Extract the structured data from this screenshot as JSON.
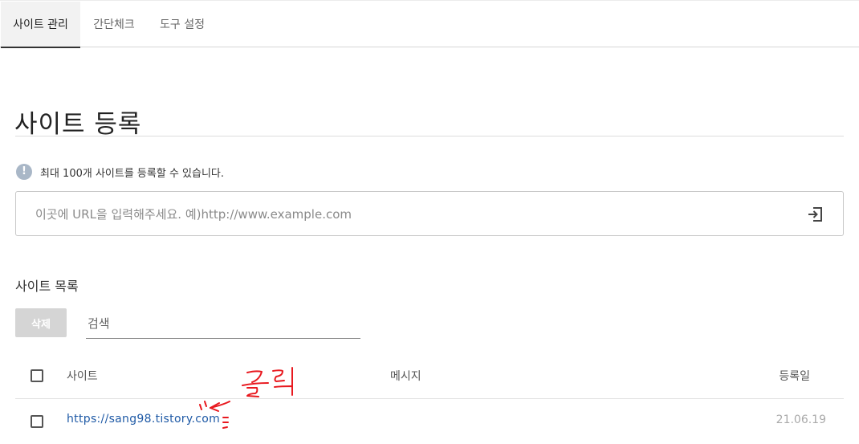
{
  "tabs": [
    {
      "label": "사이트 관리",
      "active": true
    },
    {
      "label": "간단체크",
      "active": false
    },
    {
      "label": "도구 설정",
      "active": false
    }
  ],
  "page_title": "사이트 등록",
  "info": {
    "icon": "exclamation-icon",
    "text": "최대 100개 사이트를 등록할 수 있습니다."
  },
  "url_input": {
    "placeholder": "이곳에 URL을 입력해주세요. 예)http://www.example.com",
    "value": "",
    "submit_icon": "enter-arrow-icon"
  },
  "site_list": {
    "title": "사이트 목록",
    "delete_label": "삭제",
    "search_placeholder": "검색",
    "columns": {
      "site": "사이트",
      "message": "메시지",
      "date": "등록일"
    },
    "rows": [
      {
        "site": "https://sang98.tistory.com",
        "message": "",
        "date": "21.06.19"
      }
    ]
  },
  "annotation": {
    "text": "클릭",
    "color": "#e8191f"
  },
  "colors": {
    "link": "#1f5aa6",
    "info_icon": "#a9b7c7",
    "delete_button": "#d5d5d5"
  }
}
